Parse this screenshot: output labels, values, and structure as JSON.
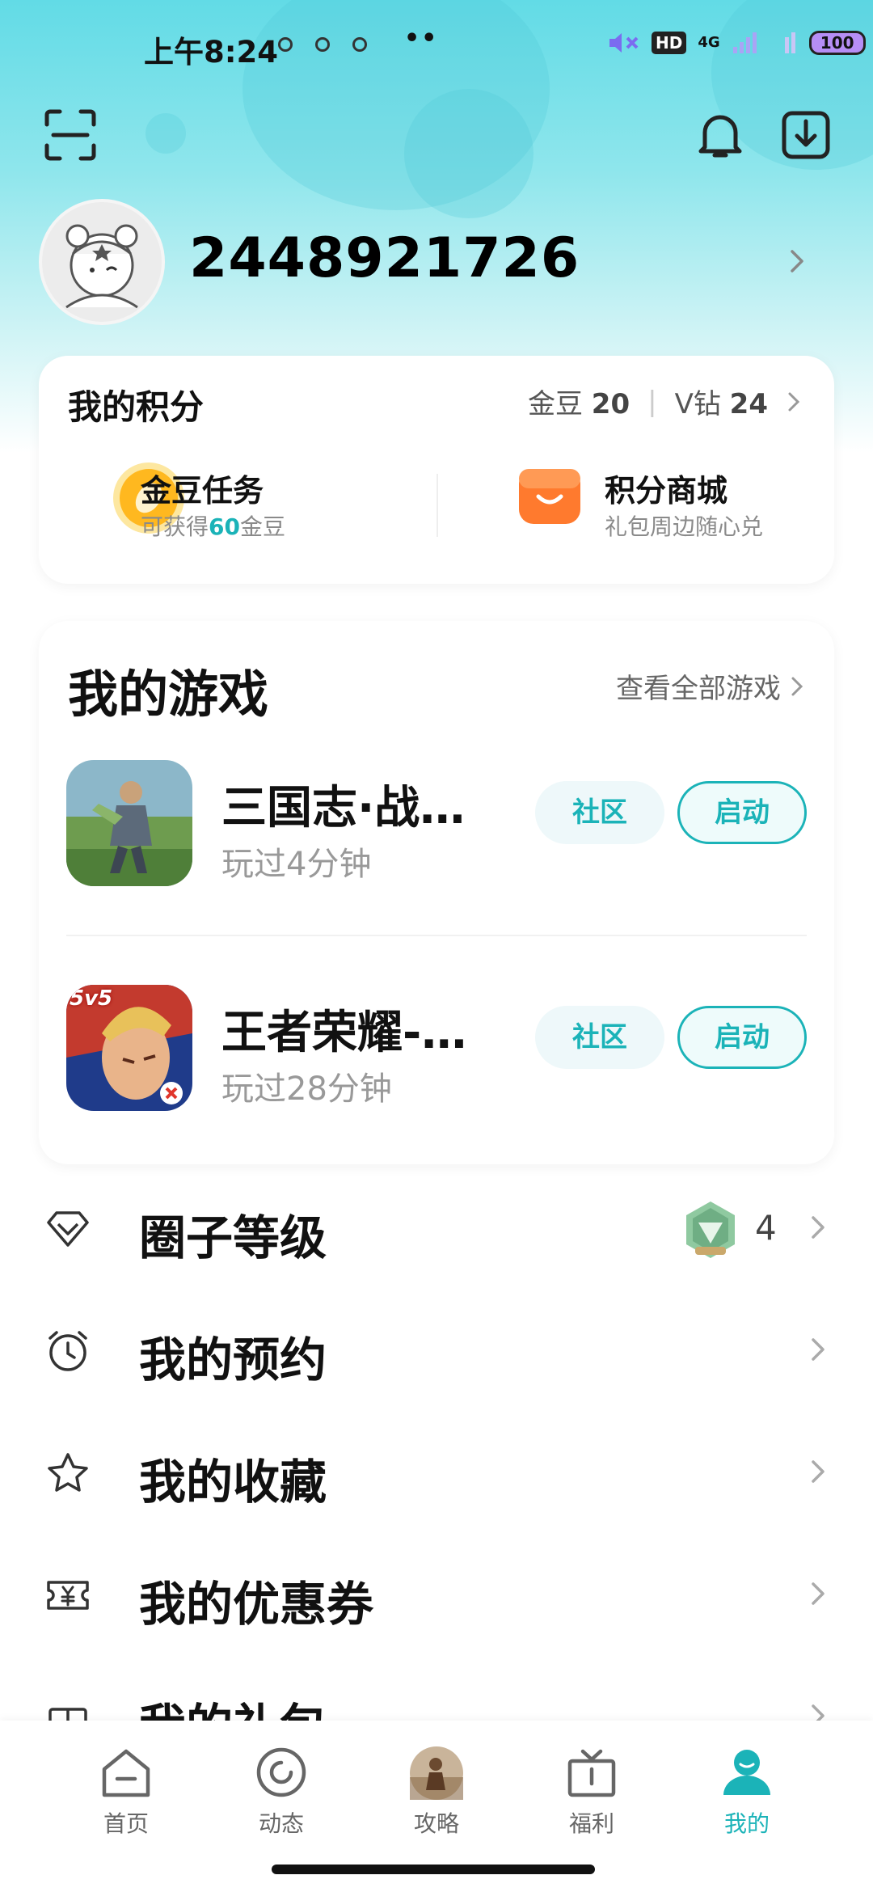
{
  "status_bar": {
    "time": "上午8:24",
    "dots": "••",
    "hd": "HD",
    "network": "4G",
    "battery": "100"
  },
  "profile": {
    "user_id": "2448921726"
  },
  "points": {
    "title": "我的积分",
    "gold_label": "金豆",
    "gold_value": "20",
    "vdiamond_label": "V钻",
    "vdiamond_value": "24",
    "tiles": [
      {
        "title": "金豆任务",
        "sub_prefix": "可获得",
        "sub_highlight": "60",
        "sub_suffix": "金豆"
      },
      {
        "title": "积分商城",
        "sub": "礼包周边随心兑"
      }
    ]
  },
  "games": {
    "title": "我的游戏",
    "see_all": "查看全部游戏",
    "items": [
      {
        "name": "三国志·战…",
        "played": "玩过4分钟",
        "community": "社区",
        "launch": "启动"
      },
      {
        "name": "王者荣耀-…",
        "played": "玩过28分钟",
        "community": "社区",
        "launch": "启动",
        "badge": "5v5"
      }
    ]
  },
  "menu": {
    "items": [
      {
        "label": "圈子等级",
        "value": "4"
      },
      {
        "label": "我的预约"
      },
      {
        "label": "我的收藏"
      },
      {
        "label": "我的优惠券"
      },
      {
        "label": "我的礼包"
      }
    ]
  },
  "bottom_nav": {
    "items": [
      {
        "label": "首页"
      },
      {
        "label": "动态"
      },
      {
        "label": "攻略"
      },
      {
        "label": "福利"
      },
      {
        "label": "我的"
      }
    ]
  },
  "colors": {
    "accent": "#1bb3b8",
    "hero_top": "#62dbe6"
  }
}
